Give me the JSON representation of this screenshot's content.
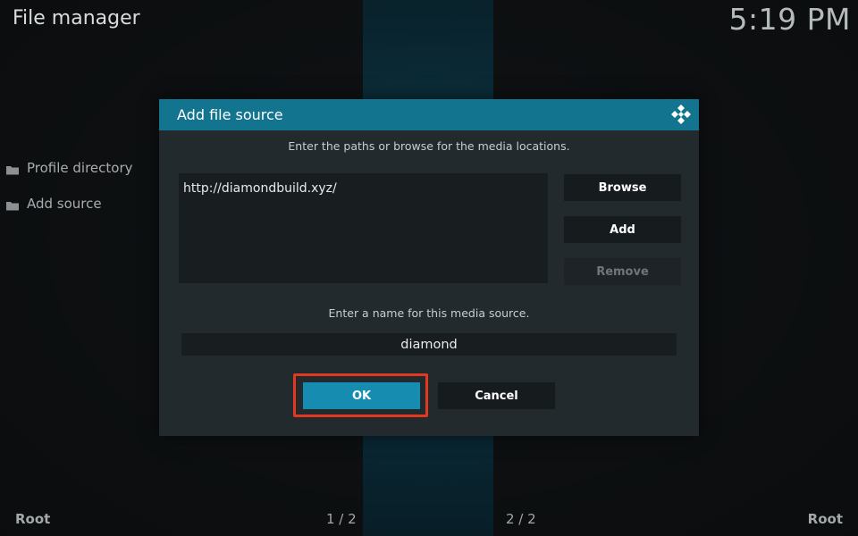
{
  "header": {
    "title": "File manager",
    "clock": "5:19 PM"
  },
  "sidebar": {
    "items": [
      {
        "label": "Profile directory",
        "icon": "folder-icon"
      },
      {
        "label": "Add source",
        "icon": "folder-icon"
      }
    ]
  },
  "footer": {
    "left": "Root",
    "page_left": "1 / 2",
    "page_right": "2 / 2",
    "right": "Root"
  },
  "dialog": {
    "title": "Add file source",
    "logo_icon": "kodi-logo-icon",
    "paths_prompt": "Enter the paths or browse for the media locations.",
    "paths": [
      "http://diamondbuild.xyz/"
    ],
    "buttons": {
      "browse": "Browse",
      "add": "Add",
      "remove": "Remove"
    },
    "name_prompt": "Enter a name for this media source.",
    "name_value": "diamond",
    "ok_label": "OK",
    "cancel_label": "Cancel"
  },
  "colors": {
    "accent": "#13748f",
    "ok": "#168cb0",
    "highlight": "#e0391f"
  }
}
